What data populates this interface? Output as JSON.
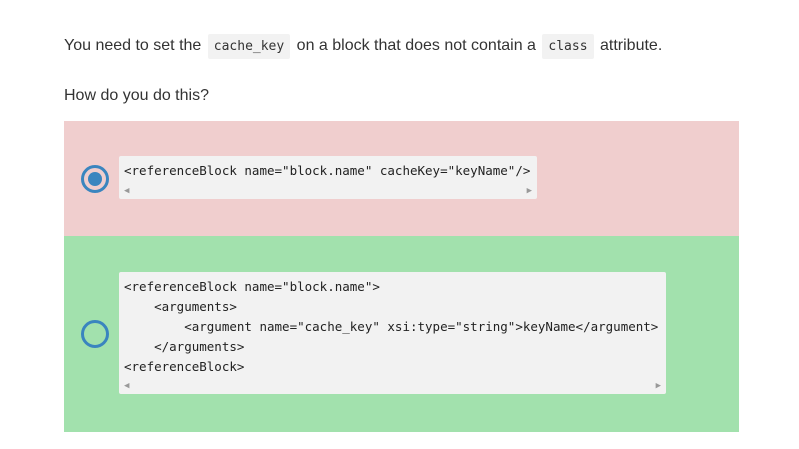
{
  "question": {
    "text_before": "You need to set the",
    "code_1": "cache_key",
    "text_middle": "on a block that does not contain a",
    "code_2": "class",
    "text_after": "attribute.",
    "prompt": "How do you do this?"
  },
  "options": [
    {
      "selected": true,
      "state_color": "#f0cece",
      "code_lines": [
        "<referenceBlock name=\"block.name\" cacheKey=\"keyName\"/>"
      ]
    },
    {
      "selected": false,
      "state_color": "#a2e1ad",
      "code_lines": [
        "<referenceBlock name=\"block.name\">",
        "    <arguments>",
        "        <argument name=\"cache_key\" xsi:type=\"string\">keyName</argument>",
        "    </arguments>",
        "<referenceBlock>"
      ]
    }
  ],
  "scrollbar": {
    "left_icon": "◀",
    "right_icon": "▶"
  },
  "colors": {
    "radio": "#3a85bf",
    "wrong": "#f0cece",
    "correct": "#a2e1ad",
    "code_bg": "#f2f2f2"
  }
}
